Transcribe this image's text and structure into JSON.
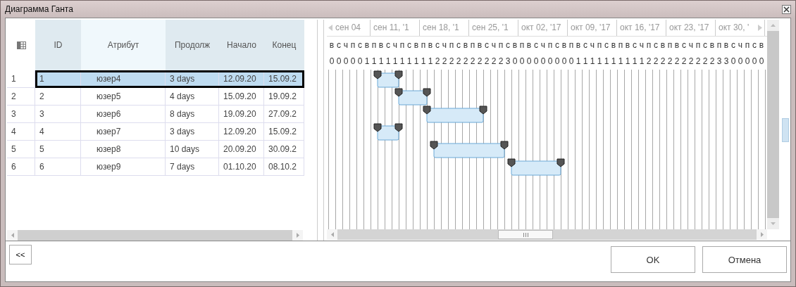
{
  "window": {
    "title": "Диаграмма Ганта"
  },
  "table": {
    "columns": [
      "ID",
      "Атрибут",
      "Продолж",
      "Начало",
      "Конец"
    ],
    "rows": [
      {
        "number": "1",
        "cells": [
          "1",
          "юзер4",
          "3 days",
          "12.09.20",
          "15.09.2"
        ],
        "selected": true
      },
      {
        "number": "2",
        "cells": [
          "2",
          "юзер5",
          "4 days",
          "15.09.20",
          "19.09.2"
        ],
        "selected": false
      },
      {
        "number": "3",
        "cells": [
          "3",
          "юзер6",
          "8 days",
          "19.09.20",
          "27.09.2"
        ],
        "selected": false
      },
      {
        "number": "4",
        "cells": [
          "4",
          "юзер7",
          "3 days",
          "12.09.20",
          "15.09.2"
        ],
        "selected": false
      },
      {
        "number": "5",
        "cells": [
          "5",
          "юзер8",
          "10 days",
          "20.09.20",
          "30.09.2"
        ],
        "selected": false
      },
      {
        "number": "6",
        "cells": [
          "6",
          "юзер9",
          "7 days",
          "01.10.20",
          "08.10.2"
        ],
        "selected": false
      }
    ]
  },
  "gantt": {
    "weeks": [
      "сен 04",
      "сен 11, '1",
      "сен 18, '1",
      "сен 25, '1",
      "окт 02, '17",
      "окт 09, '17",
      "окт 16, '17",
      "окт 23, '17",
      "окт 30, '"
    ],
    "day_letters": [
      "в",
      "с",
      "ч",
      "п",
      "с",
      "в",
      "п",
      "в",
      "с",
      "ч",
      "п",
      "с",
      "в",
      "п",
      "в",
      "с",
      "ч",
      "п",
      "с",
      "в",
      "п",
      "в",
      "с",
      "ч",
      "п",
      "с",
      "в",
      "п",
      "в",
      "с",
      "ч",
      "п",
      "с",
      "в",
      "п",
      "в",
      "с",
      "ч",
      "п",
      "с",
      "в",
      "п",
      "в",
      "с",
      "ч",
      "п",
      "с",
      "в",
      "п",
      "в",
      "с",
      "ч",
      "п",
      "с",
      "в",
      "п",
      "в",
      "с",
      "ч",
      "п",
      "с",
      "в"
    ],
    "day_digits": [
      "0",
      "0",
      "0",
      "0",
      "0",
      "1",
      "1",
      "1",
      "1",
      "1",
      "1",
      "1",
      "1",
      "1",
      "1",
      "2",
      "2",
      "2",
      "2",
      "2",
      "2",
      "2",
      "2",
      "2",
      "2",
      "3",
      "0",
      "0",
      "0",
      "0",
      "0",
      "0",
      "0",
      "0",
      "0",
      "1",
      "1",
      "1",
      "1",
      "1",
      "1",
      "1",
      "1",
      "1",
      "1",
      "2",
      "2",
      "2",
      "2",
      "2",
      "2",
      "2",
      "2",
      "2",
      "2",
      "3",
      "3",
      "0",
      "0",
      "0",
      "0",
      "0"
    ]
  },
  "buttons": {
    "collapse": "<<",
    "ok": "OK",
    "cancel": "Отмена"
  }
}
